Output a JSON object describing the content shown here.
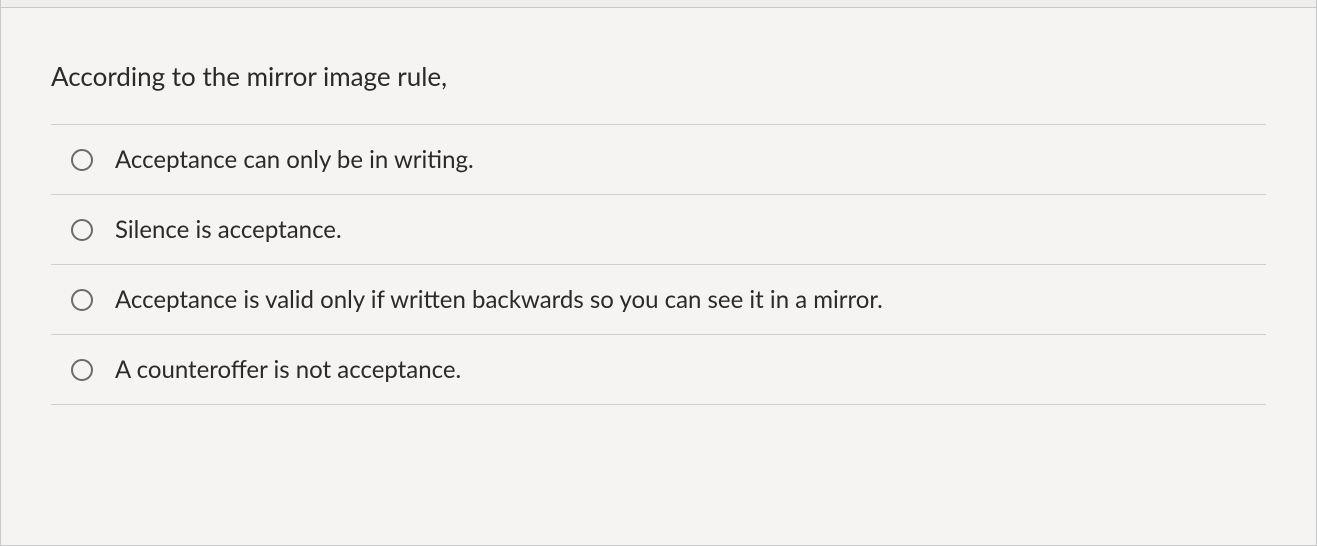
{
  "question": {
    "prompt": "According to the mirror image rule,",
    "options": [
      {
        "label": "Acceptance can only be in writing."
      },
      {
        "label": "Silence is acceptance."
      },
      {
        "label": "Acceptance is valid only if written backwards so you can see it in a mirror."
      },
      {
        "label": "A counteroffer is not acceptance."
      }
    ]
  }
}
